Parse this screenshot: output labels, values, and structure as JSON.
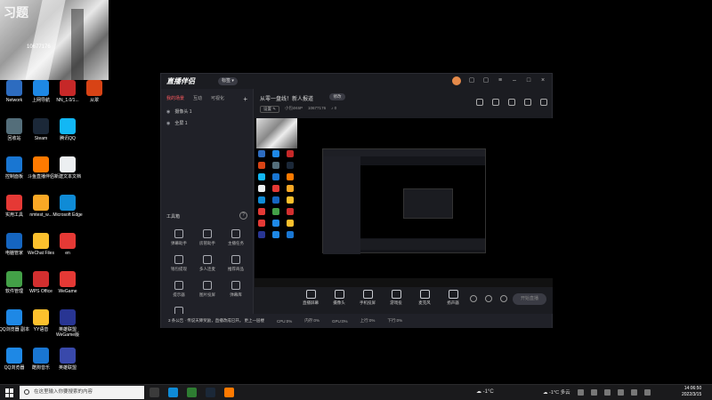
{
  "camera": {
    "mark": "习题",
    "num": "10677176"
  },
  "desktop_icons": [
    {
      "label": "Network",
      "color": "#2d6cc0"
    },
    {
      "label": "上网导航",
      "color": "#1e88e5"
    },
    {
      "label": "NN_1.0/1...",
      "color": "#c62828"
    },
    {
      "label": "从翠",
      "color": "#d84315"
    },
    {
      "label": "回收站",
      "color": "#546e7a"
    },
    {
      "label": "Steam",
      "color": "#1b2838"
    },
    {
      "label": "腾讯QQ",
      "color": "#12b7f5"
    },
    {
      "label": "控制面板",
      "color": "#1976d2"
    },
    {
      "label": "斗鱼直播伴侣",
      "color": "#ff7a00"
    },
    {
      "label": "新建文本文档",
      "color": "#eceff1"
    },
    {
      "label": "实用工具",
      "color": "#e53935"
    },
    {
      "label": "nmtest_w...",
      "color": "#f9a825"
    },
    {
      "label": "Microsoft Edge",
      "color": "#0f8bd6"
    },
    {
      "label": "电脑管家",
      "color": "#1565c0"
    },
    {
      "label": "WeChat Files",
      "color": "#fbc02d"
    },
    {
      "label": "en",
      "color": "#e53935"
    },
    {
      "label": "软件管理",
      "color": "#43a047"
    },
    {
      "label": "WPS Office",
      "color": "#d32f2f"
    },
    {
      "label": "WeGame",
      "color": "#e53935"
    },
    {
      "label": "QQ浏览器 副本",
      "color": "#1e88e5"
    },
    {
      "label": "YY语音",
      "color": "#fbc02d"
    },
    {
      "label": "英雄联盟 WeGame版",
      "color": "#283593"
    },
    {
      "label": "QQ浏览器",
      "color": "#1e88e5"
    },
    {
      "label": "酷狗音乐",
      "color": "#1976d2"
    },
    {
      "label": "英雄联盟",
      "color": "#3949ab"
    }
  ],
  "app": {
    "logo": "直播伴侣",
    "version": "标签 ▾",
    "tabs": [
      "我的场景",
      "互动",
      "可视化"
    ],
    "plus": "+",
    "scenes": [
      "摄像头 1",
      "全屏 1"
    ],
    "tools_title": "工具箱",
    "tools_help": "?",
    "tools": [
      "弹幕助手",
      "房管助手",
      "主播任务",
      "钱包提现",
      "多人连麦",
      "推荐商品",
      "提示器",
      "图片投屏",
      "弹幕库",
      "更多",
      "",
      ""
    ],
    "room_title": "从零一盘线！新人报道",
    "room_edit": "修改",
    "room_meta": [
      "设置 ✎",
      "小包4K6P",
      "10677176",
      "♪ 0"
    ],
    "bottom_items": [
      "直播屏幕",
      "摄像头",
      "手机投屏",
      "游戏投",
      "麦克风",
      "扬声器"
    ],
    "start_btn": "开始直播",
    "status": [
      "3 条公告 · 传说天降奖励，直播改成已开。 更上一层楼",
      "CPU:0%",
      "内存:0%",
      "GPU:0%",
      "上行:0%",
      "下行:0%"
    ]
  },
  "taskbar": {
    "search_placeholder": "在这里输入你要搜索的内容",
    "weather": "☁ -1°C",
    "tray_text": "☁ -1°C 多云",
    "time": "14:06:50",
    "date": "2022/3/15"
  }
}
